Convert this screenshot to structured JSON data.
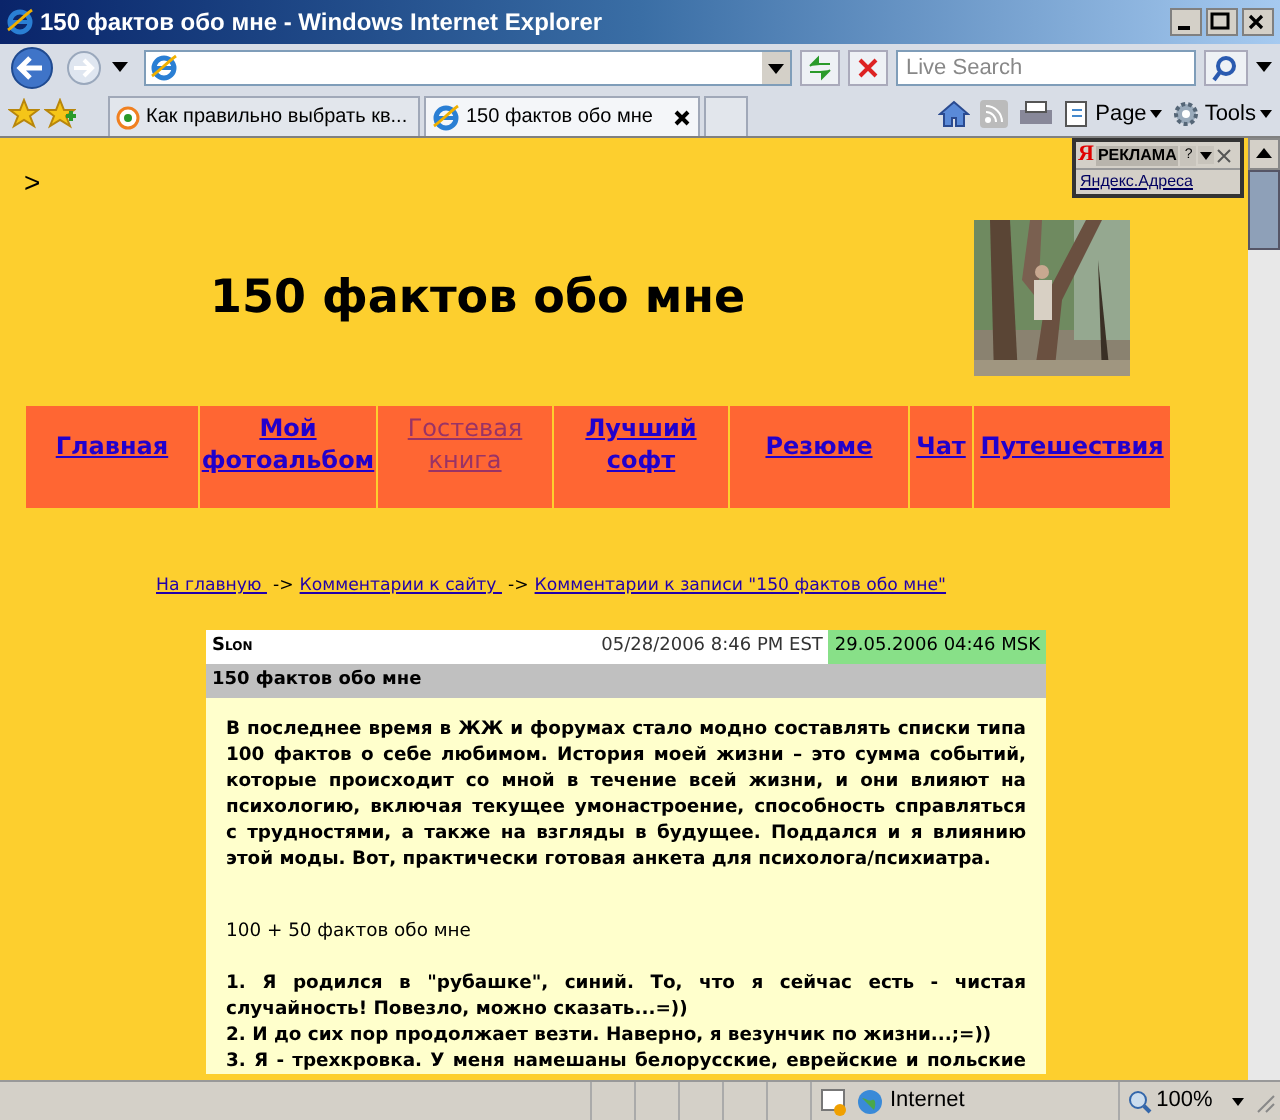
{
  "window": {
    "title": "150 фактов обо мне - Windows Internet Explorer"
  },
  "search": {
    "placeholder": "Live Search"
  },
  "tabs": [
    {
      "label": "Как правильно выбрать кв...",
      "selected": false
    },
    {
      "label": "150 фактов обо мне",
      "selected": true
    }
  ],
  "command_bar": [
    "Page",
    "Tools"
  ],
  "ad_widget": {
    "logo": "Я",
    "label": "РЕКЛАМА",
    "help": "?",
    "link": "Яндекс.Адреса"
  },
  "page": {
    "marker": ">",
    "heading": "150 фактов обо мне",
    "nav": [
      {
        "label": "Главная",
        "visited": false
      },
      {
        "label": "Мой фотоальбом",
        "visited": false
      },
      {
        "label": "Гостевая книга",
        "visited": true
      },
      {
        "label": "Лучший софт",
        "visited": false
      },
      {
        "label": "Резюме",
        "visited": false
      },
      {
        "label": "Чат",
        "visited": false
      },
      {
        "label": "Путешествия",
        "visited": false
      }
    ],
    "breadcrumb": [
      {
        "label": "На главную "
      },
      {
        "label": "Комментарии к сайту "
      },
      {
        "label": "Комментарии к записи \"150 фактов обо мне\""
      }
    ],
    "breadcrumb_separator": "->",
    "post": {
      "author": "Slon",
      "date_est": "05/28/2006 8:46 PM EST",
      "date_msk": "29.05.2006 04:46 MSK",
      "subject": "150 фактов обо мне",
      "body": [
        {
          "kind": "paragraph",
          "text": "В последнее время в ЖЖ и форумах стало модно составлять списки типа 100 фактов о себе любимом. История моей жизни – это сумма событий, которые происходит со мной в течение всей жизни, и они влияют на психологию, включая текущее умонастроение, способность справляться с трудностями, а также на взгляды в будущее. Поддался и я влиянию этой моды. Вот, практически готовая анкета для психолога/психиатра."
        },
        {
          "kind": "heading",
          "text": "100 + 50 фактов обо мне"
        },
        {
          "kind": "item",
          "text": "1. Я родился в \"рубашке\", синий. То, что я сейчас есть - чистая случайность! Повезло, можно сказать...=))"
        },
        {
          "kind": "item",
          "text": "2. И до сих пор продолжает везти. Наверно, я везунчик по жизни...;=))"
        },
        {
          "kind": "item",
          "text": "3. Я - трехкровка. У меня намешаны белорусские, еврейские и польские"
        }
      ]
    }
  },
  "status_bar": {
    "zone": "Internet",
    "zoom": "100%"
  }
}
